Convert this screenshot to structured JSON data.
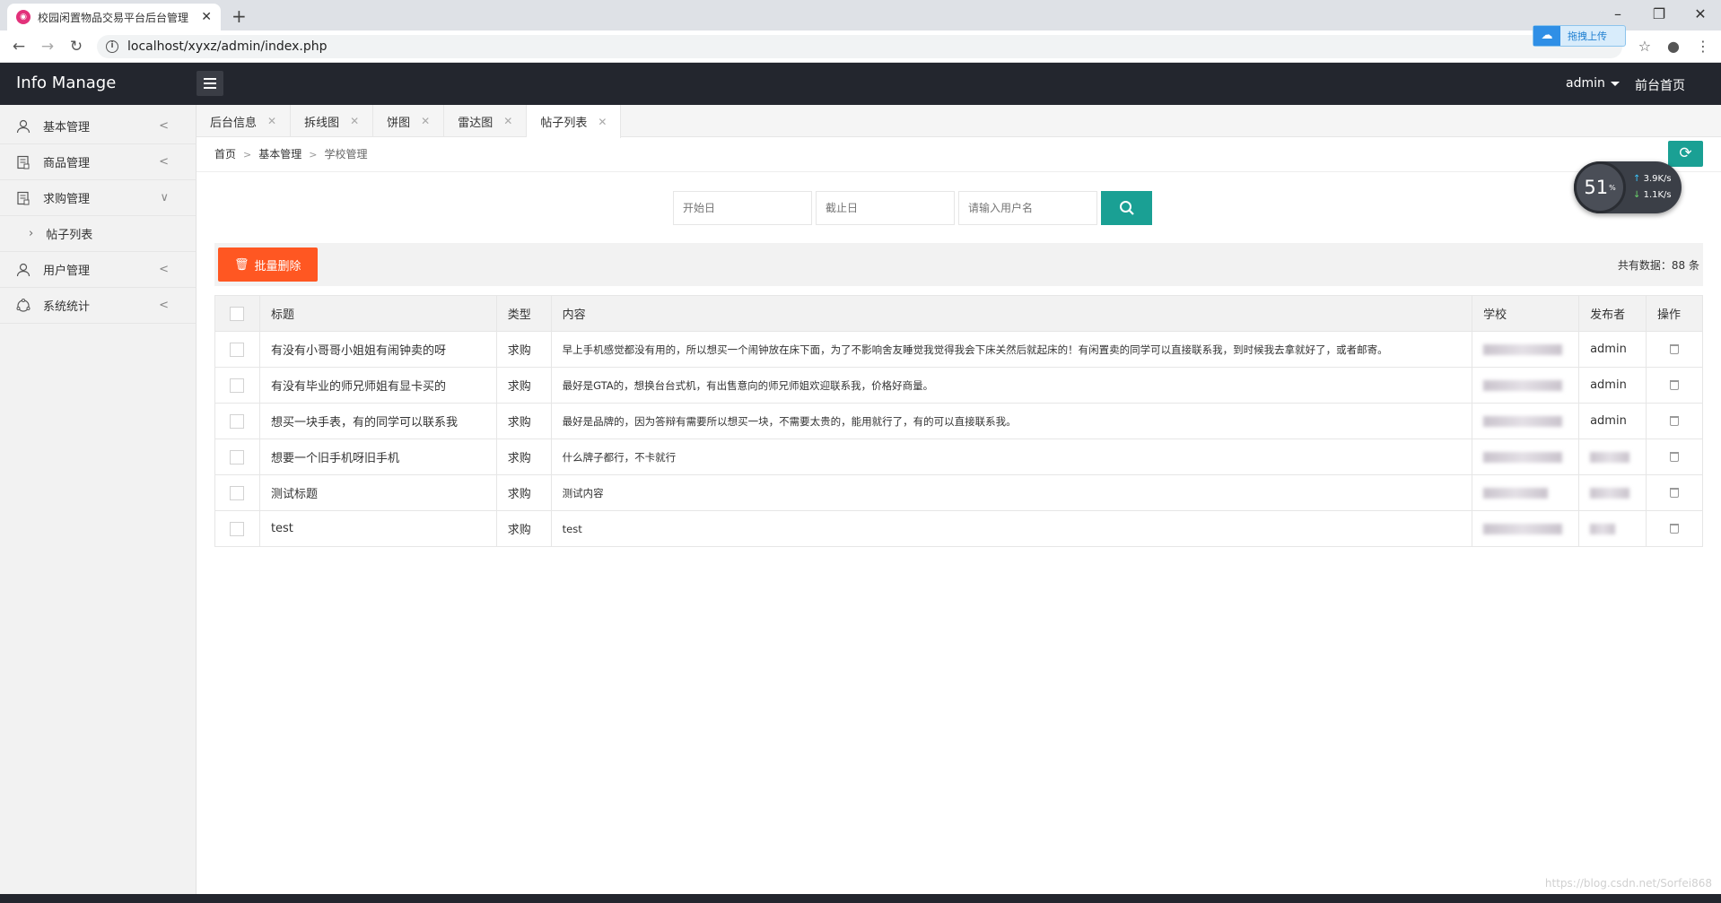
{
  "browser": {
    "tab_title": "校园闲置物品交易平台后台管理",
    "url": "localhost/xyxz/admin/index.php",
    "upload_label": "拖拽上传"
  },
  "header": {
    "logo": "Info Manage",
    "user": "admin",
    "front_link": "前台首页"
  },
  "sidebar": {
    "items": [
      {
        "label": "基本管理",
        "icon": "user-icon"
      },
      {
        "label": "商品管理",
        "icon": "goods-icon"
      },
      {
        "label": "求购管理",
        "icon": "purchase-icon"
      },
      {
        "label": "帖子列表",
        "sub": true
      },
      {
        "label": "用户管理",
        "icon": "users-icon"
      },
      {
        "label": "系统统计",
        "icon": "stats-icon"
      }
    ]
  },
  "tabs": [
    {
      "label": "后台信息",
      "active": false
    },
    {
      "label": "拆线图",
      "active": false
    },
    {
      "label": "饼图",
      "active": false
    },
    {
      "label": "雷达图",
      "active": false
    },
    {
      "label": "帖子列表",
      "active": true
    }
  ],
  "breadcrumb": {
    "home": "首页",
    "level1": "基本管理",
    "current": "学校管理"
  },
  "search": {
    "start_placeholder": "开始日",
    "end_placeholder": "截止日",
    "user_placeholder": "请输入用户名"
  },
  "toolbar": {
    "batch_delete": "批量删除",
    "total": "共有数据：88 条"
  },
  "table": {
    "headers": [
      "标题",
      "类型",
      "内容",
      "学校",
      "发布者",
      "操作"
    ],
    "rows": [
      {
        "title": "有没有小哥哥小姐姐有闹钟卖的呀",
        "type": "求购",
        "content": "早上手机感觉都没有用的，所以想买一个闹钟放在床下面，为了不影响舍友睡觉我觉得我会下床关然后就起床的！有闲置卖的同学可以直接联系我，到时候我去拿就好了，或者邮寄。",
        "publisher": "admin"
      },
      {
        "title": "有没有毕业的师兄师姐有显卡买的",
        "type": "求购",
        "content": "最好是GTA的，想换台台式机，有出售意向的师兄师姐欢迎联系我，价格好商量。",
        "publisher": "admin"
      },
      {
        "title": "想买一块手表，有的同学可以联系我",
        "type": "求购",
        "content": "最好是品牌的，因为答辩有需要所以想买一块，不需要太贵的，能用就行了，有的可以直接联系我。",
        "publisher": "admin"
      },
      {
        "title": "想要一个旧手机呀旧手机",
        "type": "求购",
        "content": "什么牌子都行，不卡就行",
        "publisher": ""
      },
      {
        "title": "测试标题",
        "type": "求购",
        "content": "测试内容",
        "publisher": ""
      },
      {
        "title": "test",
        "type": "求购",
        "content": "test",
        "publisher": ""
      }
    ]
  },
  "meter": {
    "percent": "51",
    "unit": "%",
    "up": "3.9K/s",
    "down": "1.1K/s"
  },
  "watermark": "https://blog.csdn.net/Sorfei868",
  "colors": {
    "accent": "#1aa094",
    "danger": "#ff5722",
    "header_bg": "#23262e"
  }
}
